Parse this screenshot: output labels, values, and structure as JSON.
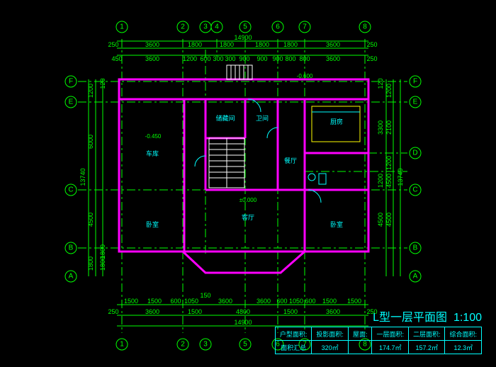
{
  "title": {
    "text": "L型一层平面图",
    "scale": "1:100"
  },
  "grid_vertical": {
    "labels": [
      "1",
      "2",
      "3",
      "4",
      "5",
      "6",
      "7",
      "8"
    ],
    "top_dims_outer": "14900",
    "top_dims_mid": [
      "250",
      "3600",
      "1800",
      "1800",
      "1800",
      "1800",
      "3600",
      "250"
    ],
    "top_dims_inner": [
      "450",
      "3600",
      "1200",
      "600",
      "300",
      "300",
      "900",
      "900",
      "900",
      "800",
      "800",
      "3600",
      "250"
    ]
  },
  "grid_horizontal": {
    "labels_left": [
      "A",
      "B",
      "C",
      "E",
      "F"
    ],
    "labels_right": [
      "A",
      "B",
      "C",
      "D",
      "E",
      "F"
    ],
    "left_dims_outer": "13740",
    "left_dims_mid": [
      "1800",
      "4500",
      "6000",
      "1200"
    ],
    "left_dims_inner": [
      "1800",
      "1800",
      "120"
    ],
    "right_dims_outer": "13740",
    "right_dims_mid": [
      "4500",
      "4500",
      "1200",
      "2100",
      "1200"
    ],
    "right_dims_inner": [
      "4500",
      "1200",
      "3300",
      "120"
    ]
  },
  "bottom_dims": {
    "inner": [
      "1500",
      "1500",
      "600",
      "1050",
      "150",
      "3600",
      "3600",
      "600",
      "1050",
      "600",
      "1500",
      "1500"
    ],
    "mid": [
      "250",
      "3600",
      "1500",
      "4800",
      "1500",
      "3600",
      "250"
    ],
    "outer": "14900"
  },
  "rooms": {
    "garage": "车库",
    "storage": "储藏间",
    "bathroom": "卫间",
    "kitchen": "厨房",
    "dining": "餐厅",
    "living": "客厅",
    "bedroom_l": "卧室",
    "bedroom_r": "卧室"
  },
  "elevations": {
    "e1": "-0.450",
    "e2": "±0.000",
    "e3": "-0.600"
  },
  "info_table": {
    "headers": [
      "户型面积:",
      "投影面积:",
      "屋面:",
      "一层面积:",
      "二层面积:",
      "综合面积:"
    ],
    "row2_label": "面积汇总",
    "values": [
      "320㎡",
      "",
      "",
      "174.7㎡",
      "157.2㎡",
      "12.3㎡"
    ]
  }
}
